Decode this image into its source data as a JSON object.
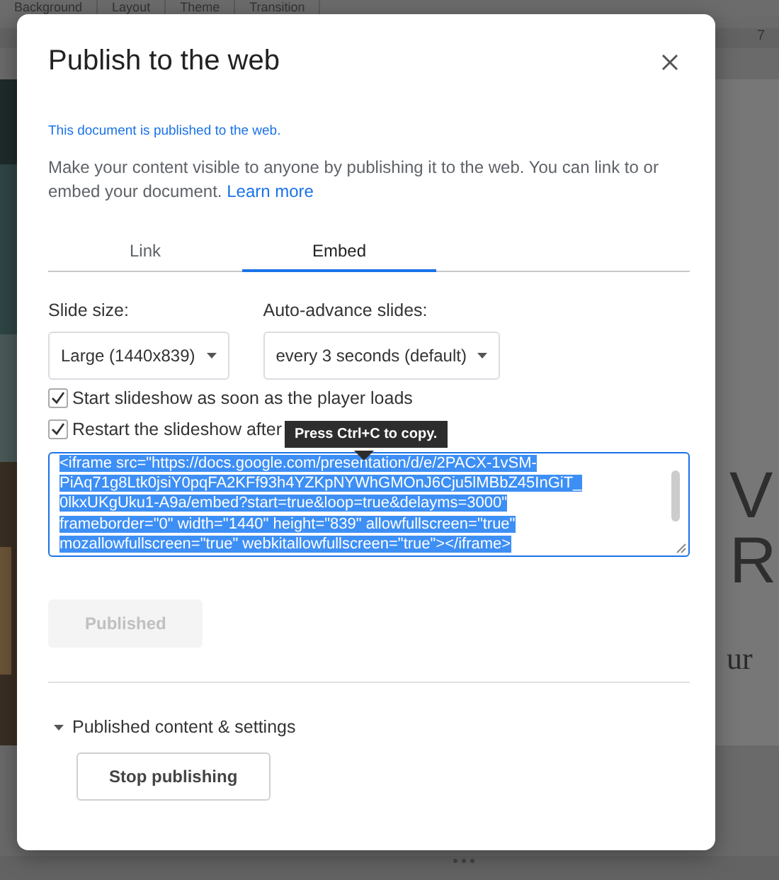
{
  "toolbar": [
    {
      "label": "Background"
    },
    {
      "label": "Layout"
    },
    {
      "label": "Theme"
    },
    {
      "label": "Transition"
    }
  ],
  "ruler_mark": "7",
  "slide_text": [
    "V",
    "R",
    "ur"
  ],
  "dialog": {
    "title": "Publish to the web",
    "status": "This document is published to the web.",
    "description": "Make your content visible to anyone by publishing it to the web. You can link to or embed your document.",
    "learn_more": "Learn more",
    "tabs": [
      {
        "label": "Link",
        "selected": false
      },
      {
        "label": "Embed",
        "selected": true
      }
    ],
    "selects": [
      {
        "label": "Slide size:",
        "value": "Large (1440x839)"
      },
      {
        "label": "Auto-advance slides:",
        "value": "every 3 seconds (default)"
      }
    ],
    "checkboxes": [
      {
        "label": "Start slideshow as soon as the player loads",
        "checked": true
      },
      {
        "label": "Restart the slideshow after",
        "checked": true
      }
    ],
    "tooltip": "Press Ctrl+C to copy.",
    "embed_code_lines": [
      "<iframe src=\"https://docs.google.com/presentation/d/e/2PACX-1vSM-",
      "PiAq71g8Ltk0jsiY0pqFA2KFf93h4YZKpNYWhGMOnJ6Cju5lMBbZ45InGiT_",
      "0lkxUKgUku1-A9a/embed?start=true&loop=true&delayms=3000\"",
      "frameborder=\"0\" width=\"1440\" height=\"839\" allowfullscreen=\"true\"",
      "mozallowfullscreen=\"true\" webkitallowfullscreen=\"true\"></iframe>"
    ],
    "publish_button": {
      "label": "Published",
      "disabled": true
    },
    "section": {
      "label": "Published content & settings",
      "expanded": true
    },
    "stop_button": "Stop publishing"
  }
}
